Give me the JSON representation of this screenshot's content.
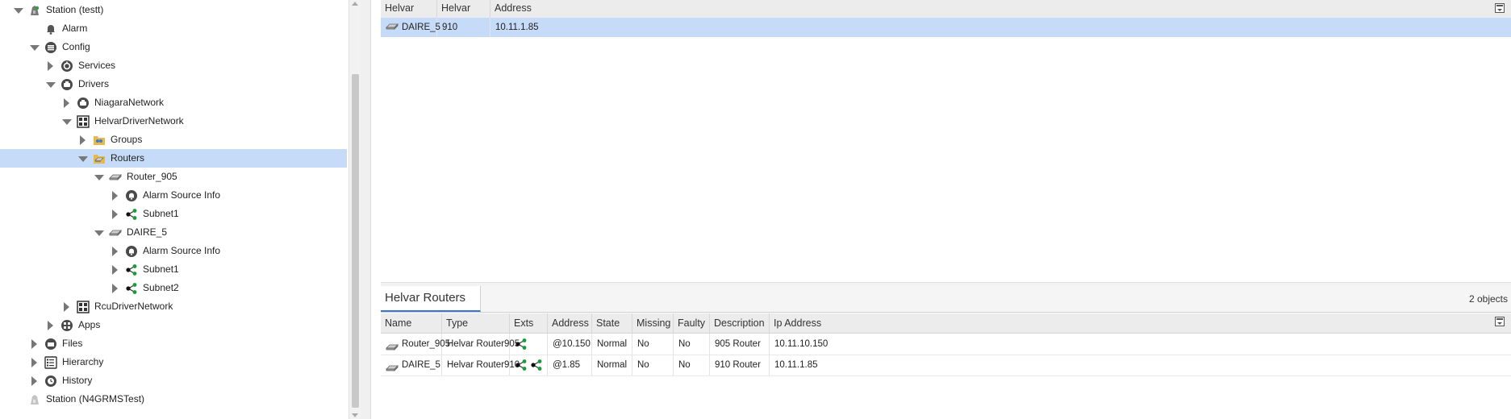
{
  "nav_tree": {
    "items": [
      {
        "label": "Station (testt)",
        "icon": "station-icon",
        "indent": 0,
        "state": "expanded"
      },
      {
        "label": "Alarm",
        "icon": "bell-icon",
        "indent": 1,
        "state": "leaf"
      },
      {
        "label": "Config",
        "icon": "config-icon",
        "indent": 1,
        "state": "expanded"
      },
      {
        "label": "Services",
        "icon": "services-icon",
        "indent": 2,
        "state": "collapsed"
      },
      {
        "label": "Drivers",
        "icon": "drivers-icon",
        "indent": 2,
        "state": "expanded"
      },
      {
        "label": "NiagaraNetwork",
        "icon": "niagara-network-icon",
        "indent": 3,
        "state": "collapsed"
      },
      {
        "label": "HelvarDriverNetwork",
        "icon": "network-grid-icon",
        "indent": 3,
        "state": "expanded"
      },
      {
        "label": "Groups",
        "icon": "folder-groups-icon",
        "indent": 4,
        "state": "collapsed"
      },
      {
        "label": "Routers",
        "icon": "folder-routers-icon",
        "indent": 4,
        "state": "expanded",
        "selected": true
      },
      {
        "label": "Router_905",
        "icon": "router-icon",
        "indent": 5,
        "state": "expanded"
      },
      {
        "label": "Alarm Source Info",
        "icon": "alarm-source-icon",
        "indent": 6,
        "state": "collapsed"
      },
      {
        "label": "Subnet1",
        "icon": "subnet-icon",
        "indent": 6,
        "state": "collapsed"
      },
      {
        "label": "DAIRE_5",
        "icon": "router-icon",
        "indent": 5,
        "state": "expanded"
      },
      {
        "label": "Alarm Source Info",
        "icon": "alarm-source-icon",
        "indent": 6,
        "state": "collapsed"
      },
      {
        "label": "Subnet1",
        "icon": "subnet-icon",
        "indent": 6,
        "state": "collapsed"
      },
      {
        "label": "Subnet2",
        "icon": "subnet-icon",
        "indent": 6,
        "state": "collapsed"
      },
      {
        "label": "RcuDriverNetwork",
        "icon": "network-grid-icon",
        "indent": 3,
        "state": "collapsed"
      },
      {
        "label": "Apps",
        "icon": "apps-icon",
        "indent": 2,
        "state": "collapsed"
      },
      {
        "label": "Files",
        "icon": "files-icon",
        "indent": 1,
        "state": "collapsed"
      },
      {
        "label": "Hierarchy",
        "icon": "hierarchy-icon",
        "indent": 1,
        "state": "collapsed"
      },
      {
        "label": "History",
        "icon": "history-icon",
        "indent": 1,
        "state": "collapsed"
      },
      {
        "label": "Station (N4GRMSTest)",
        "icon": "station-disconnected-icon",
        "indent": 0,
        "state": "leaf"
      }
    ]
  },
  "top_table": {
    "columns": [
      "Helvar Name",
      "Helvar Type",
      "Address"
    ],
    "rows": [
      {
        "name": "DAIRE_5",
        "type": "910",
        "address": "10.11.1.85",
        "selected": true
      }
    ]
  },
  "bottom_panel": {
    "tab_label": "Helvar Routers",
    "objects_count": "2 objects",
    "columns": [
      "Name",
      "Type",
      "Exts",
      "Address",
      "State",
      "Missing",
      "Faulty",
      "Description",
      "Ip Address"
    ],
    "rows": [
      {
        "name": "Router_905",
        "type": "Helvar Router905",
        "exts": [
          "subnet-icon"
        ],
        "address": "@10.150",
        "state": "Normal",
        "missing": "No",
        "faulty": "No",
        "description": "905 Router",
        "ip": "10.11.10.150"
      },
      {
        "name": "DAIRE_5",
        "type": "Helvar Router910",
        "exts": [
          "subnet-icon",
          "subnet-icon"
        ],
        "address": "@1.85",
        "state": "Normal",
        "missing": "No",
        "faulty": "No",
        "description": "910 Router",
        "ip": "10.11.1.85"
      }
    ]
  },
  "colors": {
    "selection": "#c5dbf7",
    "subnet_green": "#1a9a3a",
    "tab_accent": "#3c78c8"
  }
}
